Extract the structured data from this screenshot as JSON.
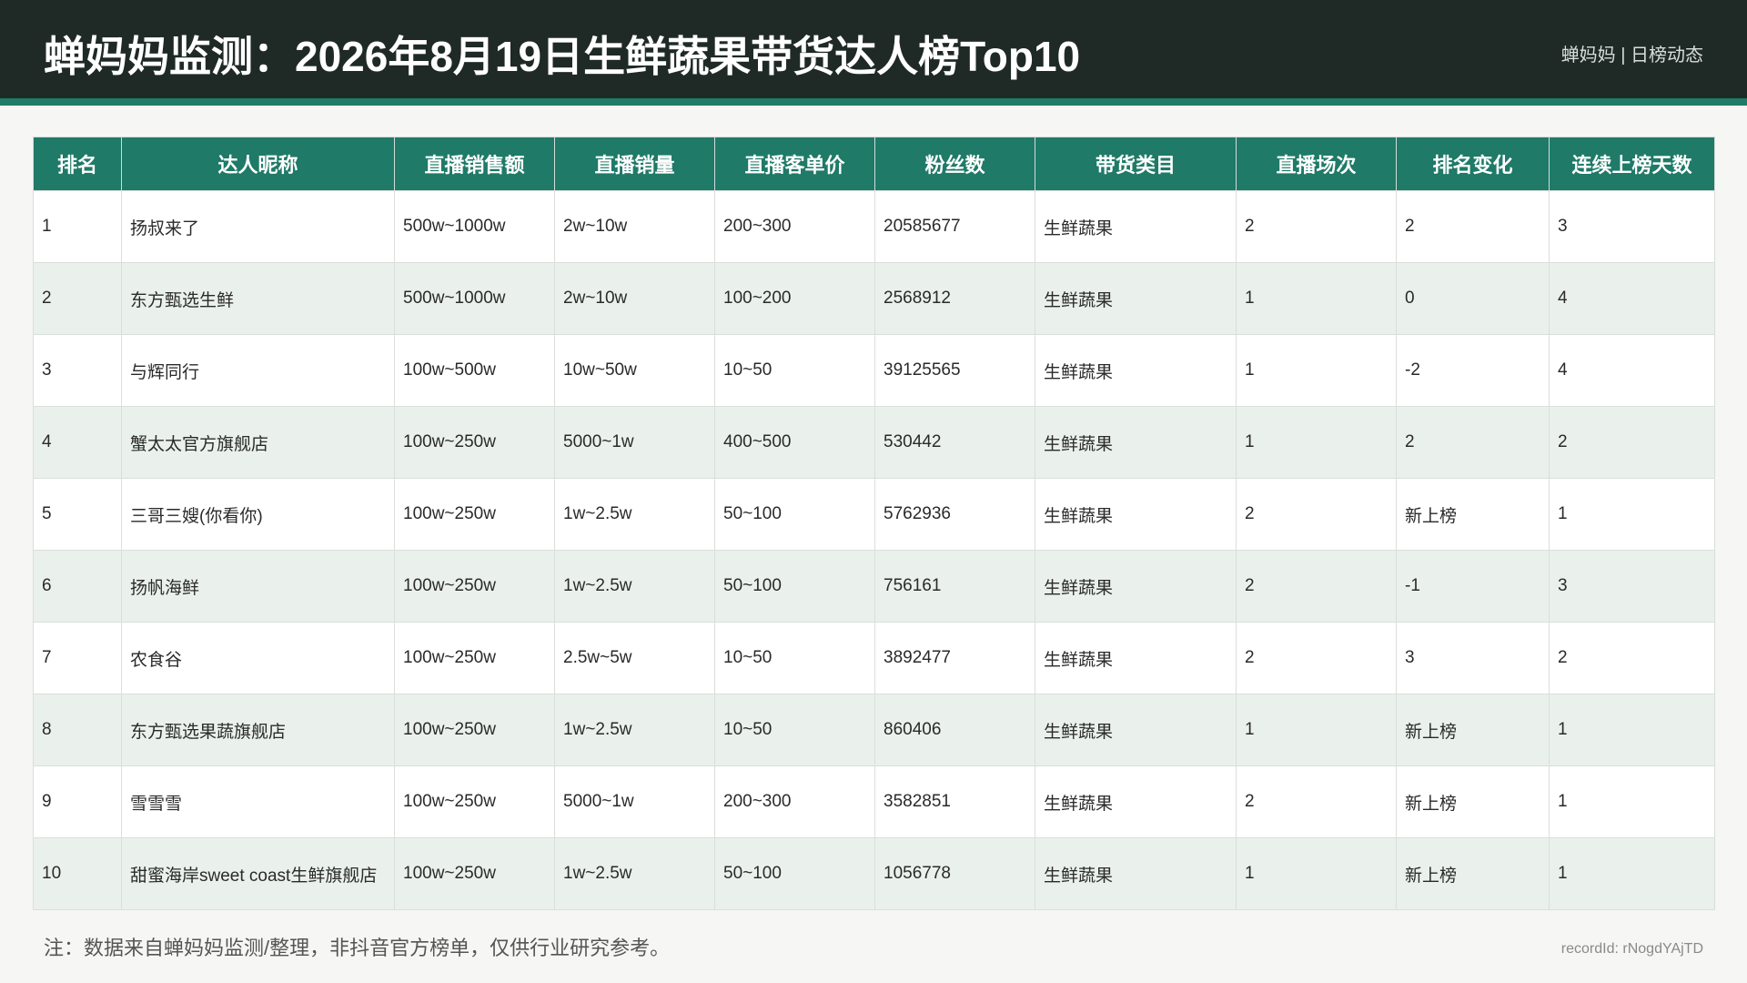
{
  "header": {
    "title": "蝉妈妈监测：2026年8月19日生鲜蔬果带货达人榜Top10",
    "brand": "蝉妈妈 | 日榜动态"
  },
  "table": {
    "columns": [
      "排名",
      "达人昵称",
      "直播销售额",
      "直播销量",
      "直播客单价",
      "粉丝数",
      "带货类目",
      "直播场次",
      "排名变化",
      "连续上榜天数"
    ],
    "rows": [
      [
        "1",
        "扬叔来了",
        "500w~1000w",
        "2w~10w",
        "200~300",
        "20585677",
        "生鲜蔬果",
        "2",
        "2",
        "3"
      ],
      [
        "2",
        "东方甄选生鲜",
        "500w~1000w",
        "2w~10w",
        "100~200",
        "2568912",
        "生鲜蔬果",
        "1",
        "0",
        "4"
      ],
      [
        "3",
        "与辉同行",
        "100w~500w",
        "10w~50w",
        "10~50",
        "39125565",
        "生鲜蔬果",
        "1",
        "-2",
        "4"
      ],
      [
        "4",
        "蟹太太官方旗舰店",
        "100w~250w",
        "5000~1w",
        "400~500",
        "530442",
        "生鲜蔬果",
        "1",
        "2",
        "2"
      ],
      [
        "5",
        "三哥三嫂(你看你)",
        "100w~250w",
        "1w~2.5w",
        "50~100",
        "5762936",
        "生鲜蔬果",
        "2",
        "新上榜",
        "1"
      ],
      [
        "6",
        "扬帆海鲜",
        "100w~250w",
        "1w~2.5w",
        "50~100",
        "756161",
        "生鲜蔬果",
        "2",
        "-1",
        "3"
      ],
      [
        "7",
        "农食谷",
        "100w~250w",
        "2.5w~5w",
        "10~50",
        "3892477",
        "生鲜蔬果",
        "2",
        "3",
        "2"
      ],
      [
        "8",
        "东方甄选果蔬旗舰店",
        "100w~250w",
        "1w~2.5w",
        "10~50",
        "860406",
        "生鲜蔬果",
        "1",
        "新上榜",
        "1"
      ],
      [
        "9",
        "雪雪雪",
        "100w~250w",
        "5000~1w",
        "200~300",
        "3582851",
        "生鲜蔬果",
        "2",
        "新上榜",
        "1"
      ],
      [
        "10",
        "甜蜜海岸sweet coast生鲜旗舰店",
        "100w~250w",
        "1w~2.5w",
        "50~100",
        "1056778",
        "生鲜蔬果",
        "1",
        "新上榜",
        "1"
      ]
    ]
  },
  "footer": {
    "note": "注：数据来自蝉妈妈监测/整理，非抖音官方榜单，仅供行业研究参考。",
    "record": "recordId: rNogdYAjTD"
  }
}
